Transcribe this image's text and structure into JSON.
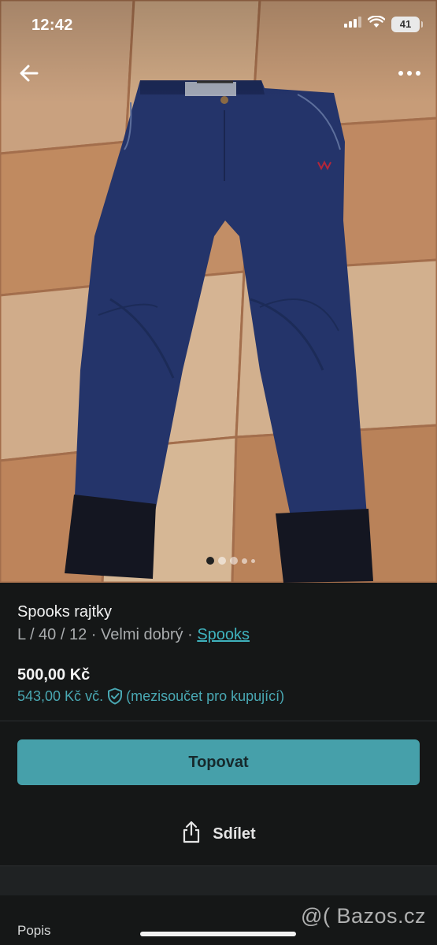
{
  "status_bar": {
    "time": "12:42",
    "battery": "41"
  },
  "gallery": {
    "image": "navy riding breeches with dark cuffs laid on a beige tiled floor",
    "dots_count": 5,
    "active_dot": 0
  },
  "listing": {
    "title": "Spooks rajtky",
    "size": "L / 40 / 12",
    "separator": "·",
    "condition": "Velmi dobrý",
    "brand": "Spooks",
    "price": "500,00 Kč",
    "total_price": "543,00 Kč vč.",
    "total_note": "(mezisoučet pro kupující)"
  },
  "actions": {
    "promote_label": "Topovat",
    "share_label": "Sdílet"
  },
  "description": {
    "heading": "Popis"
  },
  "watermark": "@( Bazos.cz",
  "colors": {
    "background": "#151717",
    "accent": "#46a0aa",
    "link": "#3fb2bd",
    "total_text": "#49a8b3"
  },
  "icons": {
    "back": "arrow-left-icon",
    "more": "more-horizontal-icon",
    "shield": "shield-check-icon",
    "share": "share-icon"
  }
}
